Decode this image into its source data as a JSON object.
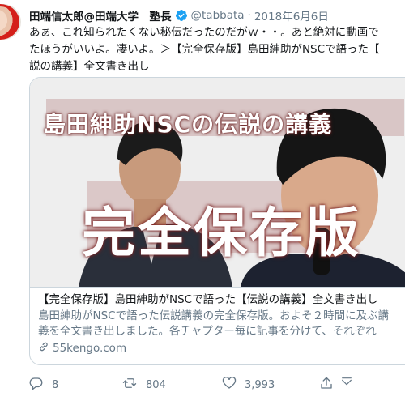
{
  "user": {
    "display_name": "田端信太郎@田端大学　塾長",
    "handle": "@tabbata",
    "separator": "·",
    "date": "2018年6月6日"
  },
  "tweet": {
    "text": "あぁ、これ知られたくない秘伝だったのだがｗ・・。あと絶対に動画で\nたほうがいいよ。凄いよ。＞【完全保存版】島田紳助がNSCで語った【\n説の講義】全文書き出し"
  },
  "card": {
    "image_overlay_title": "島田紳助NSCの伝説の講義",
    "image_overlay_big": "完全保存版",
    "title": "【完全保存版】島田紳助がNSCで語った【伝説の講義】全文書き出し",
    "description": "島田紳助がNSCで語った伝説講義の完全保存版。およそ２時間に及ぶ講\n義を全文書き出しました。各チャプター毎に記事を分けて、それぞれ",
    "link": "55kengo.com"
  },
  "actions": {
    "replies": "8",
    "retweets": "804",
    "likes": "3,993"
  },
  "colors": {
    "accent": "#1da1f2",
    "muted": "#657786",
    "border": "#ccd6dd"
  },
  "icons": [
    "verified-badge-icon",
    "reply-icon",
    "retweet-icon",
    "like-icon",
    "share-icon",
    "bookmark-icon",
    "link-icon"
  ]
}
